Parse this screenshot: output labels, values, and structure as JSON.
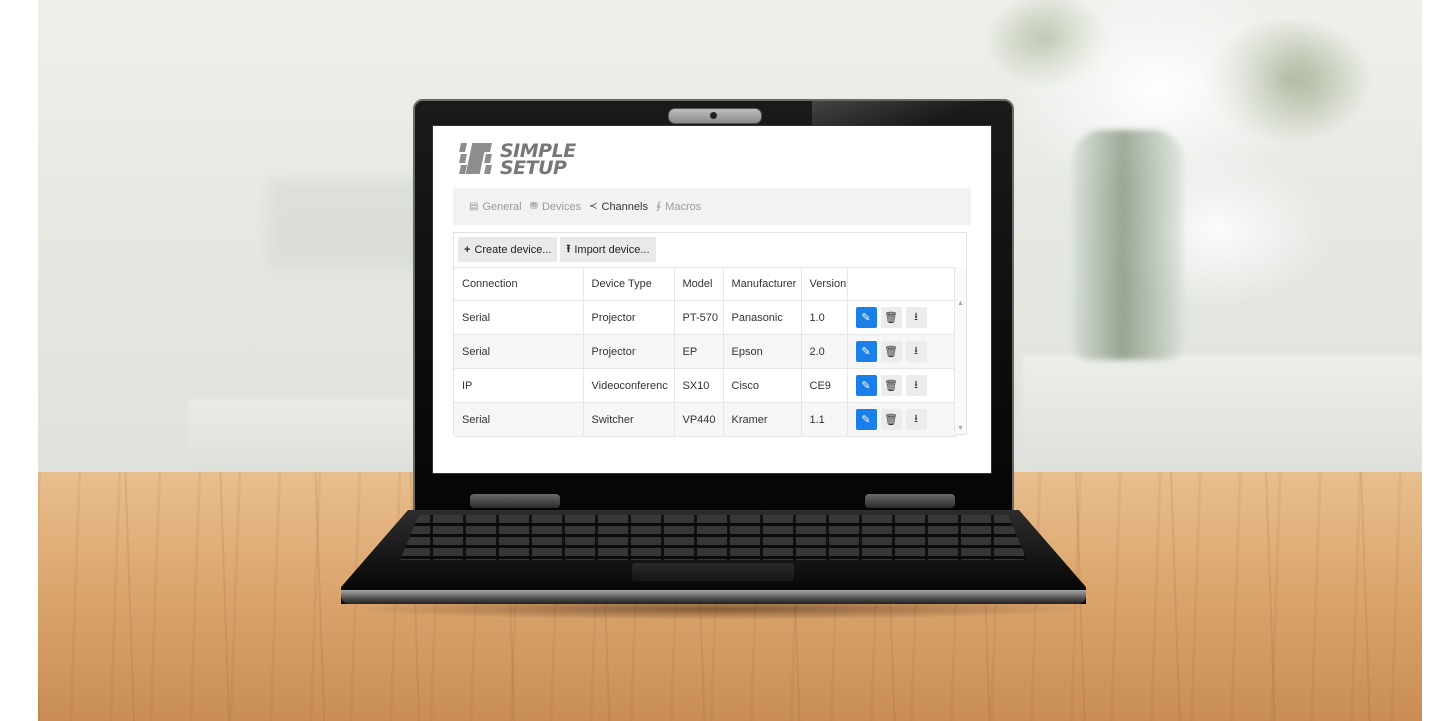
{
  "app": {
    "logo_line1": "SIMPLE",
    "logo_line2": "SETUP"
  },
  "nav": {
    "items": [
      {
        "label": "General",
        "icon": "document-icon"
      },
      {
        "label": "Devices",
        "icon": "devices-icon"
      },
      {
        "label": "Channels",
        "icon": "share-icon"
      },
      {
        "label": "Macros",
        "icon": "macro-icon"
      }
    ],
    "active": "Channels"
  },
  "toolbar": {
    "create_label": "Create device...",
    "import_label": "Import device..."
  },
  "table": {
    "columns": [
      "Connection",
      "Device Type",
      "Model",
      "Manufacturer",
      "Version"
    ],
    "rows": [
      {
        "connection": "Serial",
        "device_type": "Projector",
        "model": "PT-570",
        "manufacturer": "Panasonic",
        "version": "1.0"
      },
      {
        "connection": "Serial",
        "device_type": "Projector",
        "model": "EP",
        "manufacturer": "Epson",
        "version": "2.0"
      },
      {
        "connection": "IP",
        "device_type": "Videoconferenc",
        "model": "SX10",
        "manufacturer": "Cisco",
        "version": "CE9"
      },
      {
        "connection": "Serial",
        "device_type": "Switcher",
        "model": "VP440",
        "manufacturer": "Kramer",
        "version": "1.1"
      }
    ]
  },
  "colors": {
    "edit_button": "#1a7fe8",
    "action_button": "#ececec",
    "nav_background": "#f1f2f3"
  }
}
